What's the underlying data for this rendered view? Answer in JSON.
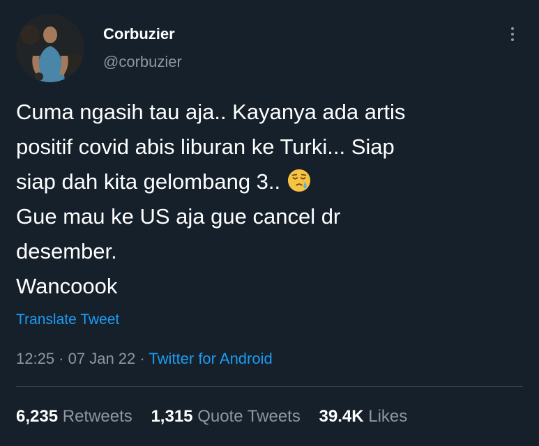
{
  "author": {
    "name": "Corbuzier",
    "handle": "@corbuzier"
  },
  "tweet": {
    "lines": [
      "Cuma ngasih tau aja.. Kayanya ada artis",
      "positif covid abis liburan ke Turki... Siap",
      "siap dah kita gelombang 3..",
      "Gue mau ke US aja gue cancel dr",
      "desember.",
      "Wancoook"
    ],
    "emoji": "sleepy-face-emoji"
  },
  "translate_label": "Translate Tweet",
  "meta": {
    "time": "12:25",
    "separator": " · ",
    "date": "07 Jan 22",
    "source": "Twitter for Android"
  },
  "stats": {
    "retweets_count": "6,235",
    "retweets_label": "Retweets",
    "quotes_count": "1,315",
    "quotes_label": "Quote Tweets",
    "likes_count": "39.4K",
    "likes_label": "Likes"
  },
  "colors": {
    "background": "#15202b",
    "link": "#1d9bf0",
    "secondary_text": "#8b98a5",
    "divider": "#38444d"
  }
}
